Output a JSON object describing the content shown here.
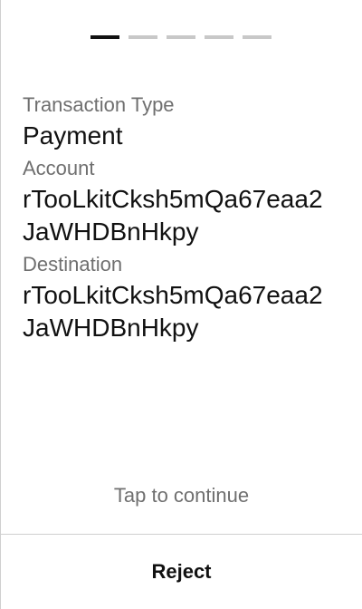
{
  "stepper": {
    "total_steps": 5,
    "current_step": 1,
    "active_color": "#111111",
    "inactive_color": "#c8c8c8"
  },
  "transaction": {
    "type_label": "Transaction Type",
    "type_value": "Payment",
    "account_label": "Account",
    "account_value": "rTooLkitCksh5mQa67eaa2JaWHDBnHkpy",
    "destination_label": "Destination",
    "destination_value": "rTooLkitCksh5mQa67eaa2JaWHDBnHkpy"
  },
  "footer": {
    "tap_hint": "Tap to continue",
    "reject_label": "Reject"
  }
}
